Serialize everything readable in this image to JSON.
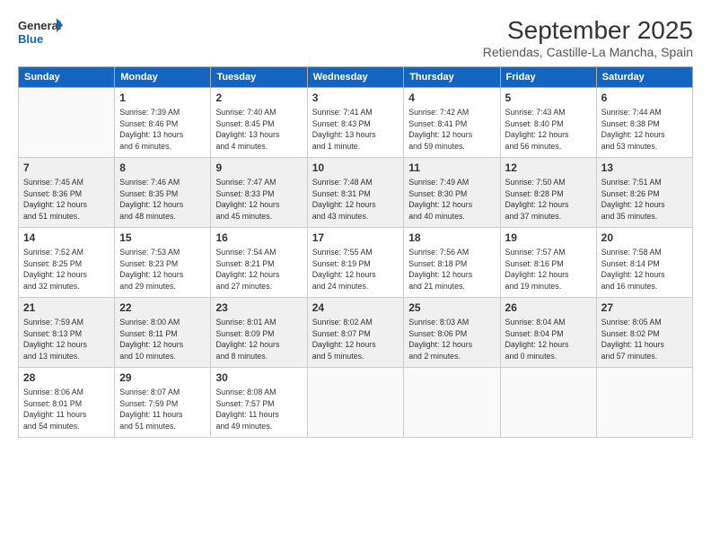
{
  "logo": {
    "line1": "General",
    "line2": "Blue"
  },
  "title": "September 2025",
  "subtitle": "Retiendas, Castille-La Mancha, Spain",
  "days_of_week": [
    "Sunday",
    "Monday",
    "Tuesday",
    "Wednesday",
    "Thursday",
    "Friday",
    "Saturday"
  ],
  "weeks": [
    [
      {
        "day": "",
        "info": ""
      },
      {
        "day": "1",
        "info": "Sunrise: 7:39 AM\nSunset: 8:46 PM\nDaylight: 13 hours\nand 6 minutes."
      },
      {
        "day": "2",
        "info": "Sunrise: 7:40 AM\nSunset: 8:45 PM\nDaylight: 13 hours\nand 4 minutes."
      },
      {
        "day": "3",
        "info": "Sunrise: 7:41 AM\nSunset: 8:43 PM\nDaylight: 13 hours\nand 1 minute."
      },
      {
        "day": "4",
        "info": "Sunrise: 7:42 AM\nSunset: 8:41 PM\nDaylight: 12 hours\nand 59 minutes."
      },
      {
        "day": "5",
        "info": "Sunrise: 7:43 AM\nSunset: 8:40 PM\nDaylight: 12 hours\nand 56 minutes."
      },
      {
        "day": "6",
        "info": "Sunrise: 7:44 AM\nSunset: 8:38 PM\nDaylight: 12 hours\nand 53 minutes."
      }
    ],
    [
      {
        "day": "7",
        "info": "Sunrise: 7:45 AM\nSunset: 8:36 PM\nDaylight: 12 hours\nand 51 minutes."
      },
      {
        "day": "8",
        "info": "Sunrise: 7:46 AM\nSunset: 8:35 PM\nDaylight: 12 hours\nand 48 minutes."
      },
      {
        "day": "9",
        "info": "Sunrise: 7:47 AM\nSunset: 8:33 PM\nDaylight: 12 hours\nand 45 minutes."
      },
      {
        "day": "10",
        "info": "Sunrise: 7:48 AM\nSunset: 8:31 PM\nDaylight: 12 hours\nand 43 minutes."
      },
      {
        "day": "11",
        "info": "Sunrise: 7:49 AM\nSunset: 8:30 PM\nDaylight: 12 hours\nand 40 minutes."
      },
      {
        "day": "12",
        "info": "Sunrise: 7:50 AM\nSunset: 8:28 PM\nDaylight: 12 hours\nand 37 minutes."
      },
      {
        "day": "13",
        "info": "Sunrise: 7:51 AM\nSunset: 8:26 PM\nDaylight: 12 hours\nand 35 minutes."
      }
    ],
    [
      {
        "day": "14",
        "info": "Sunrise: 7:52 AM\nSunset: 8:25 PM\nDaylight: 12 hours\nand 32 minutes."
      },
      {
        "day": "15",
        "info": "Sunrise: 7:53 AM\nSunset: 8:23 PM\nDaylight: 12 hours\nand 29 minutes."
      },
      {
        "day": "16",
        "info": "Sunrise: 7:54 AM\nSunset: 8:21 PM\nDaylight: 12 hours\nand 27 minutes."
      },
      {
        "day": "17",
        "info": "Sunrise: 7:55 AM\nSunset: 8:19 PM\nDaylight: 12 hours\nand 24 minutes."
      },
      {
        "day": "18",
        "info": "Sunrise: 7:56 AM\nSunset: 8:18 PM\nDaylight: 12 hours\nand 21 minutes."
      },
      {
        "day": "19",
        "info": "Sunrise: 7:57 AM\nSunset: 8:16 PM\nDaylight: 12 hours\nand 19 minutes."
      },
      {
        "day": "20",
        "info": "Sunrise: 7:58 AM\nSunset: 8:14 PM\nDaylight: 12 hours\nand 16 minutes."
      }
    ],
    [
      {
        "day": "21",
        "info": "Sunrise: 7:59 AM\nSunset: 8:13 PM\nDaylight: 12 hours\nand 13 minutes."
      },
      {
        "day": "22",
        "info": "Sunrise: 8:00 AM\nSunset: 8:11 PM\nDaylight: 12 hours\nand 10 minutes."
      },
      {
        "day": "23",
        "info": "Sunrise: 8:01 AM\nSunset: 8:09 PM\nDaylight: 12 hours\nand 8 minutes."
      },
      {
        "day": "24",
        "info": "Sunrise: 8:02 AM\nSunset: 8:07 PM\nDaylight: 12 hours\nand 5 minutes."
      },
      {
        "day": "25",
        "info": "Sunrise: 8:03 AM\nSunset: 8:06 PM\nDaylight: 12 hours\nand 2 minutes."
      },
      {
        "day": "26",
        "info": "Sunrise: 8:04 AM\nSunset: 8:04 PM\nDaylight: 12 hours\nand 0 minutes."
      },
      {
        "day": "27",
        "info": "Sunrise: 8:05 AM\nSunset: 8:02 PM\nDaylight: 11 hours\nand 57 minutes."
      }
    ],
    [
      {
        "day": "28",
        "info": "Sunrise: 8:06 AM\nSunset: 8:01 PM\nDaylight: 11 hours\nand 54 minutes."
      },
      {
        "day": "29",
        "info": "Sunrise: 8:07 AM\nSunset: 7:59 PM\nDaylight: 11 hours\nand 51 minutes."
      },
      {
        "day": "30",
        "info": "Sunrise: 8:08 AM\nSunset: 7:57 PM\nDaylight: 11 hours\nand 49 minutes."
      },
      {
        "day": "",
        "info": ""
      },
      {
        "day": "",
        "info": ""
      },
      {
        "day": "",
        "info": ""
      },
      {
        "day": "",
        "info": ""
      }
    ]
  ]
}
